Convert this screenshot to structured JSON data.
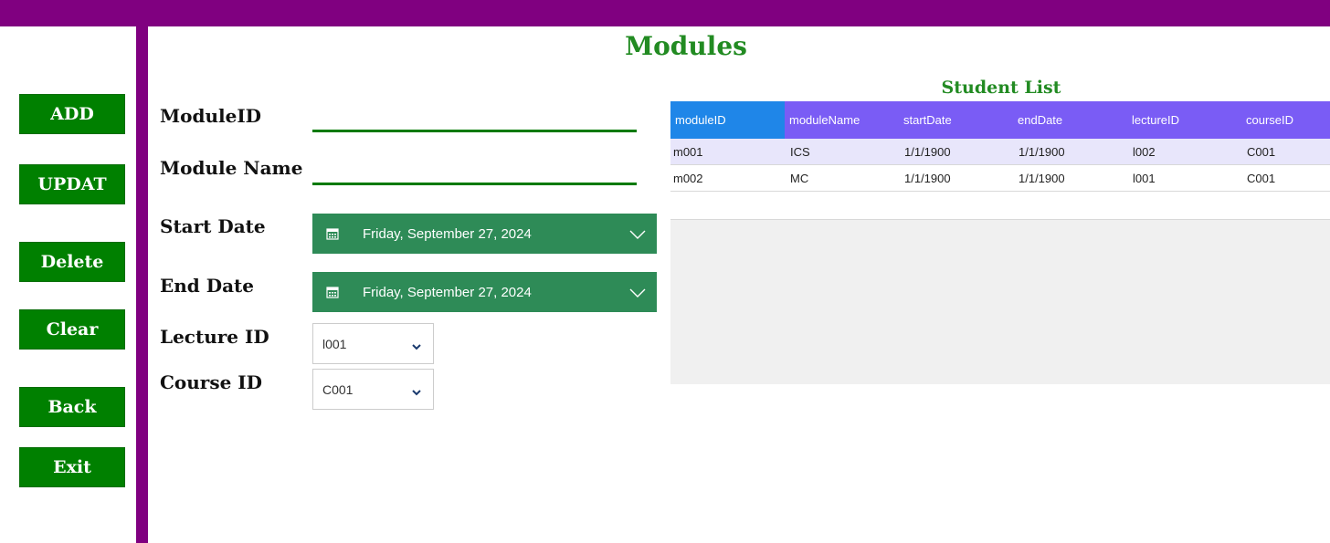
{
  "window": {
    "title": "Modules"
  },
  "sidebar": {
    "buttons": [
      {
        "label": "ADD"
      },
      {
        "label": "UPDAT"
      },
      {
        "label": "Delete"
      },
      {
        "label": "Clear"
      },
      {
        "label": "Back"
      },
      {
        "label": "Exit"
      }
    ]
  },
  "form": {
    "module_id": {
      "label": "ModuleID",
      "value": ""
    },
    "module_name": {
      "label": "Module Name",
      "value": ""
    },
    "start_date": {
      "label": "Start Date",
      "value": "Friday, September 27, 2024",
      "icon": "calendar-icon"
    },
    "end_date": {
      "label": "End Date",
      "value": "Friday, September 27, 2024",
      "icon": "calendar-icon"
    },
    "lecture_id": {
      "label": "Lecture ID",
      "value": "l001"
    },
    "course_id": {
      "label": "Course ID",
      "value": "C001"
    }
  },
  "grid": {
    "title": "Student List",
    "columns": [
      "moduleID",
      "moduleName",
      "startDate",
      "endDate",
      "lectureID",
      "courseID"
    ],
    "rows": [
      [
        "m001",
        "ICS",
        "1/1/1900",
        "1/1/1900",
        "l002",
        "C001"
      ],
      [
        "m002",
        "MC",
        "1/1/1900",
        "1/1/1900",
        "l001",
        "C001"
      ]
    ]
  },
  "colors": {
    "frame": "#800080",
    "button": "#008000",
    "title": "#228B22",
    "datepicker": "#2e8b57",
    "grid_header": "#7a5cf5",
    "grid_header_selected": "#1f86e8",
    "grid_row_alt": "#e8e6fb"
  }
}
